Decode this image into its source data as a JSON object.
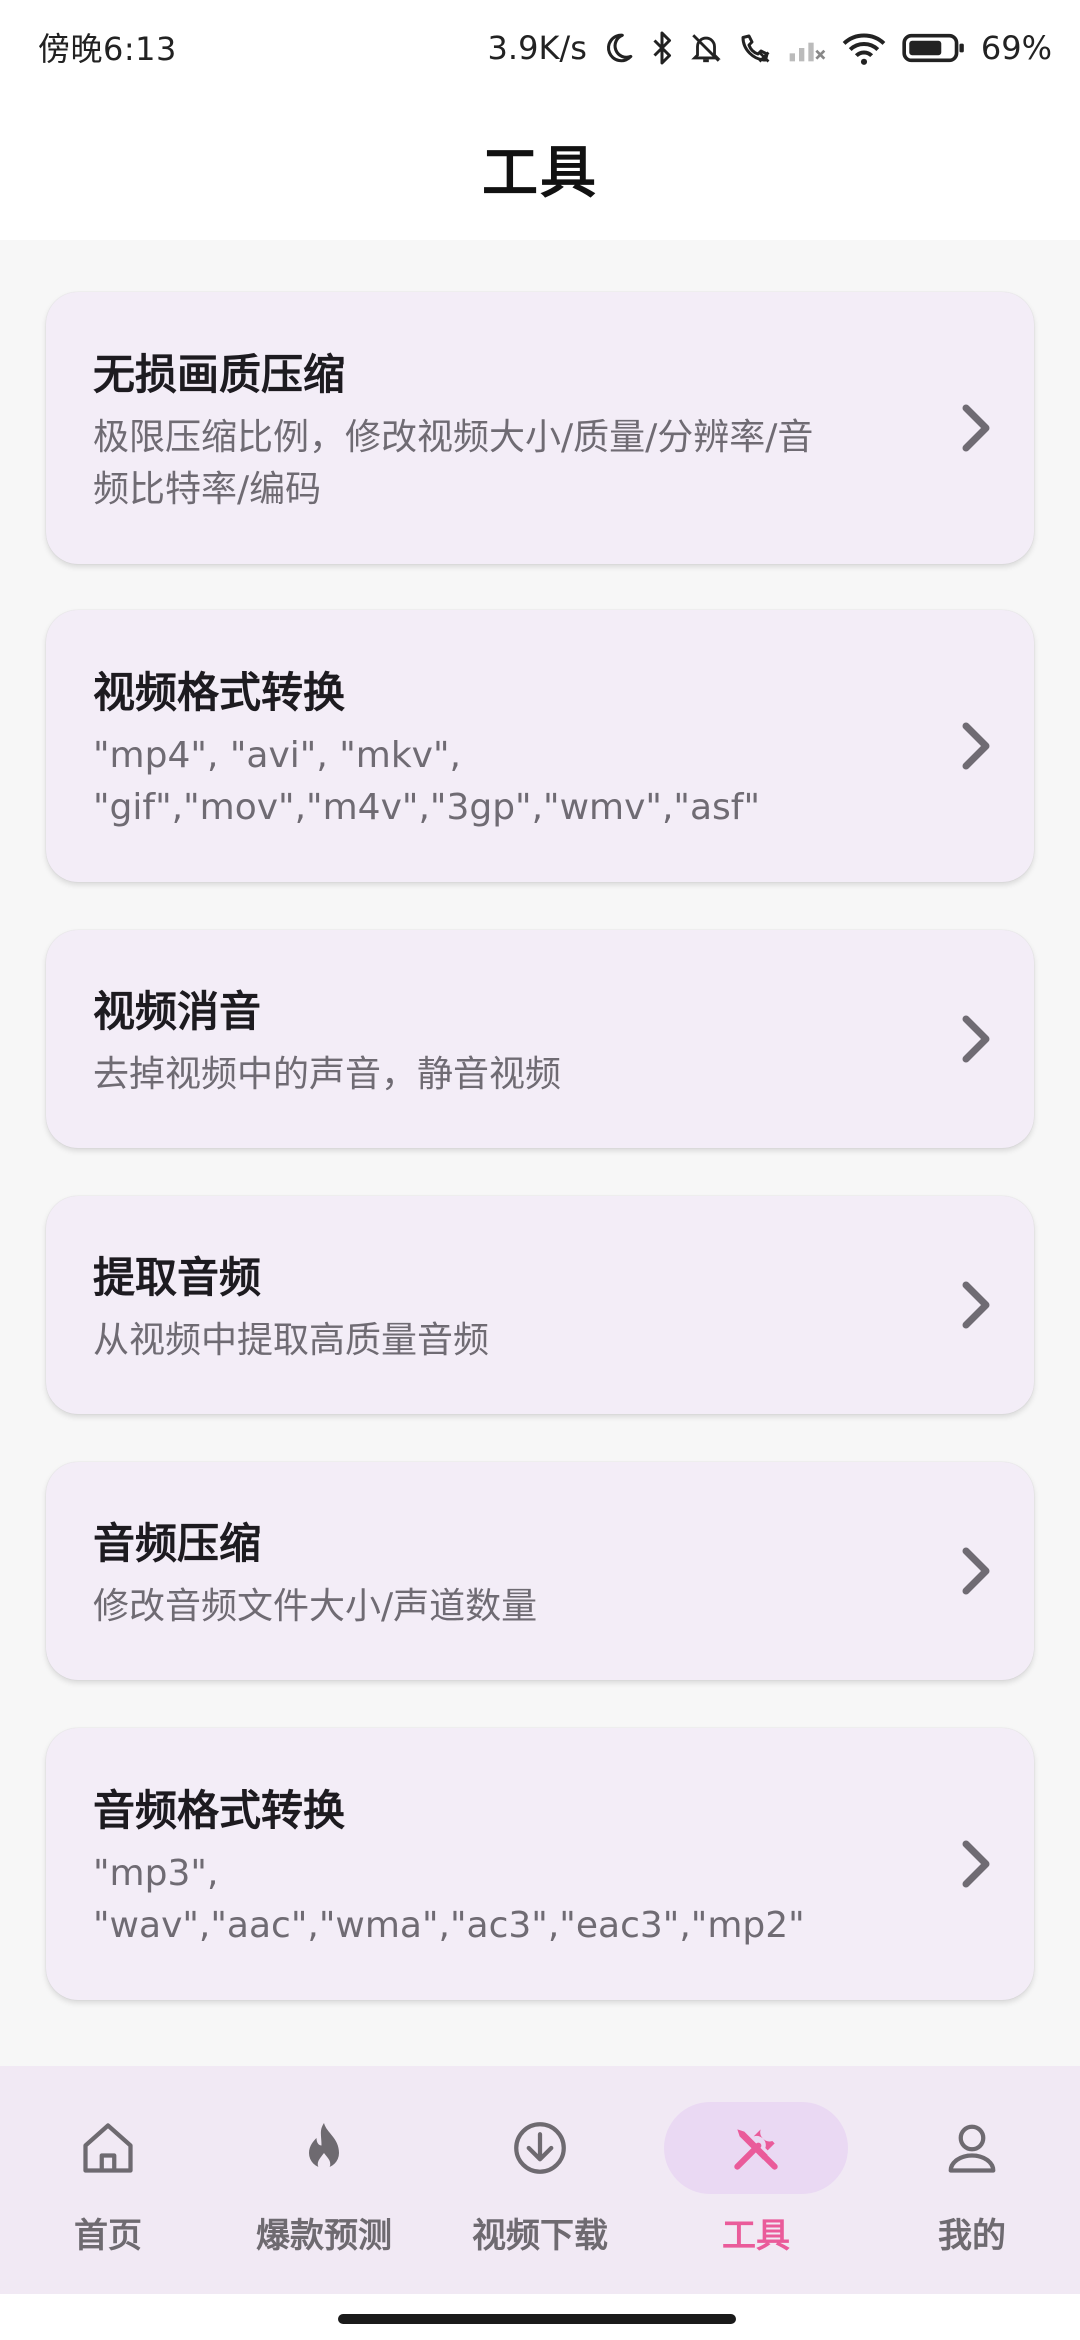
{
  "status_bar": {
    "time": "傍晚6:13",
    "network_speed": "3.9K/s",
    "battery_percent": "69%",
    "icons": [
      "moon-icon",
      "bluetooth-icon",
      "mute-bell-icon",
      "call-off-icon",
      "signal-off-icon",
      "wifi-icon",
      "battery-icon"
    ]
  },
  "header": {
    "title": "工具"
  },
  "tools": [
    {
      "title": "无损画质压缩",
      "description": "极限压缩比例，修改视频大小/质量/分辨率/音\n频比特率/编码"
    },
    {
      "title": "视频格式转换",
      "description": "\"mp4\", \"avi\", \"mkv\",\n\"gif\",\"mov\",\"m4v\",\"3gp\",\"wmv\",\"asf\""
    },
    {
      "title": "视频消音",
      "description": "去掉视频中的声音，静音视频"
    },
    {
      "title": "提取音频",
      "description": "从视频中提取高质量音频"
    },
    {
      "title": "音频压缩",
      "description": "修改音频文件大小/声道数量"
    },
    {
      "title": "音频格式转换",
      "description": "\"mp3\",\n\"wav\",\"aac\",\"wma\",\"ac3\",\"eac3\",\"mp2\""
    }
  ],
  "bottom_nav": {
    "items": [
      {
        "label": "首页",
        "icon": "home-icon"
      },
      {
        "label": "爆款预测",
        "icon": "fire-icon"
      },
      {
        "label": "视频下载",
        "icon": "download-icon"
      },
      {
        "label": "工具",
        "icon": "tools-icon",
        "active": true
      },
      {
        "label": "我的",
        "icon": "person-icon"
      }
    ]
  },
  "colors": {
    "accent": "#ea5b9a",
    "card_bg": "#f3edf7",
    "nav_bg": "#f1e9f4",
    "active_pill": "#ead9f3"
  }
}
